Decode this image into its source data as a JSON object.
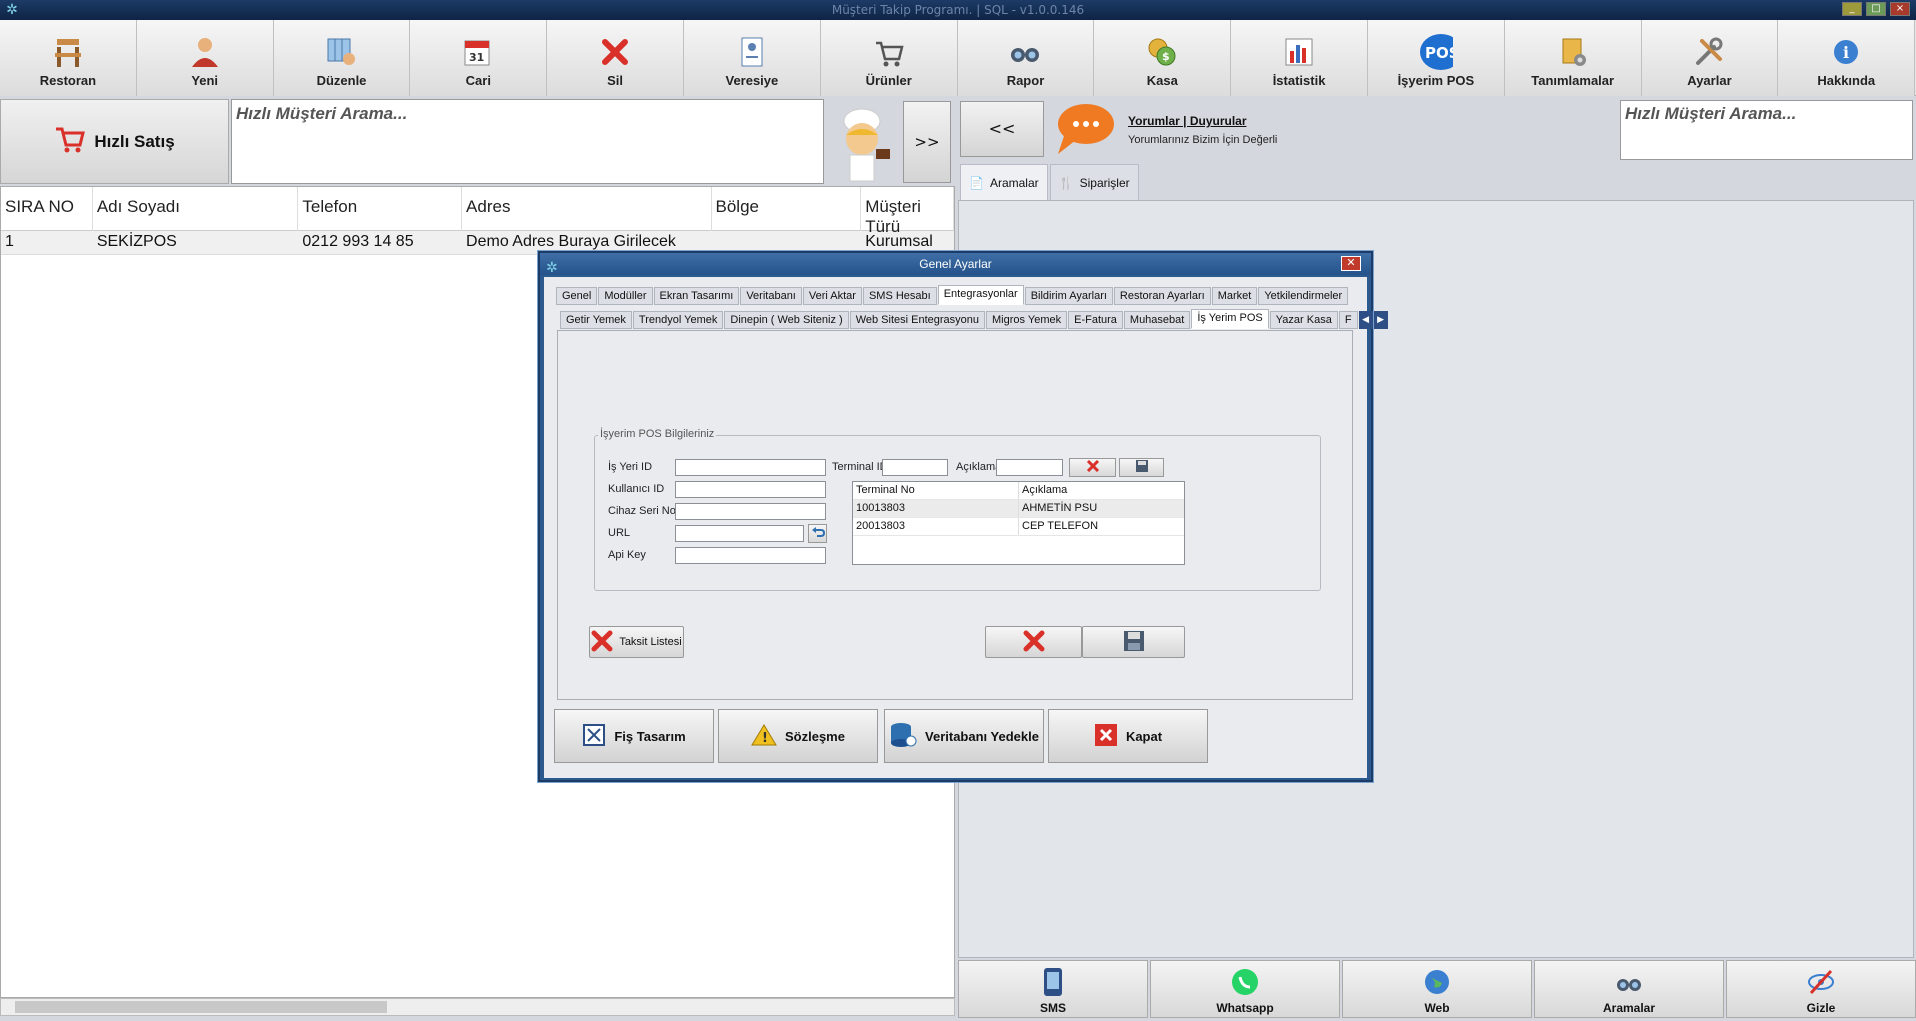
{
  "window": {
    "title": "Müşteri Takip Programı. | SQL - v1.0.0.146"
  },
  "toolbar": [
    {
      "label": "Restoran",
      "icon": "restaurant-icon"
    },
    {
      "label": "Yeni",
      "icon": "new-customer-icon"
    },
    {
      "label": "Düzenle",
      "icon": "edit-grid-icon"
    },
    {
      "label": "Cari",
      "icon": "calendar-icon"
    },
    {
      "label": "Sil",
      "icon": "delete-icon"
    },
    {
      "label": "Veresiye",
      "icon": "credit-card-icon"
    },
    {
      "label": "Ürünler",
      "icon": "cart-icon"
    },
    {
      "label": "Rapor",
      "icon": "binoculars-icon"
    },
    {
      "label": "Kasa",
      "icon": "coins-icon"
    },
    {
      "label": "İstatistik",
      "icon": "chart-icon"
    },
    {
      "label": "İşyerim POS",
      "icon": "pos-icon"
    },
    {
      "label": "Tanımlamalar",
      "icon": "definitions-icon"
    },
    {
      "label": "Ayarlar",
      "icon": "tools-icon"
    },
    {
      "label": "Hakkında",
      "icon": "info-icon"
    }
  ],
  "left": {
    "quick_sale": "Hızlı Satış",
    "search_placeholder": "Hızlı Müşteri Arama...",
    "next_label": ">>",
    "columns": [
      "SIRA NO",
      "Adı Soyadı",
      "Telefon",
      "Adres",
      "Bölge",
      "Müşteri Türü"
    ],
    "rows": [
      {
        "sira": "1",
        "ad": "SEKİZPOS",
        "tel": "0212 993 14 85",
        "adres": "Demo Adres Buraya Girilecek",
        "bolge": "",
        "tur": "Kurumsal"
      }
    ]
  },
  "right": {
    "prev_label": "<<",
    "announce_title": "Yorumlar | Duyurular",
    "announce_sub": "Yorumlarınız Bizim İçin Değerli",
    "search_placeholder": "Hızlı Müşteri Arama...",
    "tabs": [
      "Aramalar",
      "Siparişler"
    ]
  },
  "bottombar": [
    {
      "label": "SMS",
      "icon": "phone-icon"
    },
    {
      "label": "Whatsapp",
      "icon": "whatsapp-icon"
    },
    {
      "label": "Web",
      "icon": "globe-icon"
    },
    {
      "label": "Aramalar",
      "icon": "binoculars-icon"
    },
    {
      "label": "Gizle",
      "icon": "hide-icon"
    }
  ],
  "dialog": {
    "title": "Genel Ayarlar",
    "tabs1": [
      "Genel",
      "Modüller",
      "Ekran Tasarımı",
      "Veritabanı",
      "Veri Aktar",
      "SMS Hesabı",
      "Entegrasyonlar",
      "Bildirim Ayarları",
      "Restoran Ayarları",
      "Market",
      "Yetkilendirmeler"
    ],
    "tabs1_active": "Entegrasyonlar",
    "tabs2": [
      "Getir Yemek",
      "Trendyol Yemek",
      "Dinepin ( Web Siteniz )",
      "Web Sitesi Entegrasyonu",
      "Migros Yemek",
      "E-Fatura",
      "Muhasebat",
      "İş Yerim POS",
      "Yazar Kasa",
      "F"
    ],
    "tabs2_active": "İş Yerim POS",
    "group_title": "İşyerim POS Bilgileriniz",
    "fields": {
      "isyeri_id": "İş Yeri ID",
      "kullanici_id": "Kullanıcı ID",
      "cihaz_seri": "Cihaz Seri No",
      "url": "URL",
      "api_key": "Api Key",
      "terminal_id": "Terminal ID",
      "aciklama": "Açıklama"
    },
    "terminal_table": {
      "headers": [
        "Terminal No",
        "Açıklama"
      ],
      "rows": [
        {
          "no": "10013803",
          "aciklama": "AHMETİN PSU"
        },
        {
          "no": "20013803",
          "aciklama": "CEP TELEFON"
        }
      ]
    },
    "taksit_label": "Taksit Listesi",
    "footer": [
      {
        "label": "Fiş Tasarım",
        "icon": "receipt-design-icon"
      },
      {
        "label": "Sözleşme",
        "icon": "warning-icon"
      },
      {
        "label": "Veritabanı Yedekle",
        "icon": "database-backup-icon"
      },
      {
        "label": "Kapat",
        "icon": "close-icon"
      }
    ]
  },
  "colors": {
    "accent": "#2c5a8e",
    "delete": "#d9302a",
    "whatsapp": "#25d366"
  }
}
